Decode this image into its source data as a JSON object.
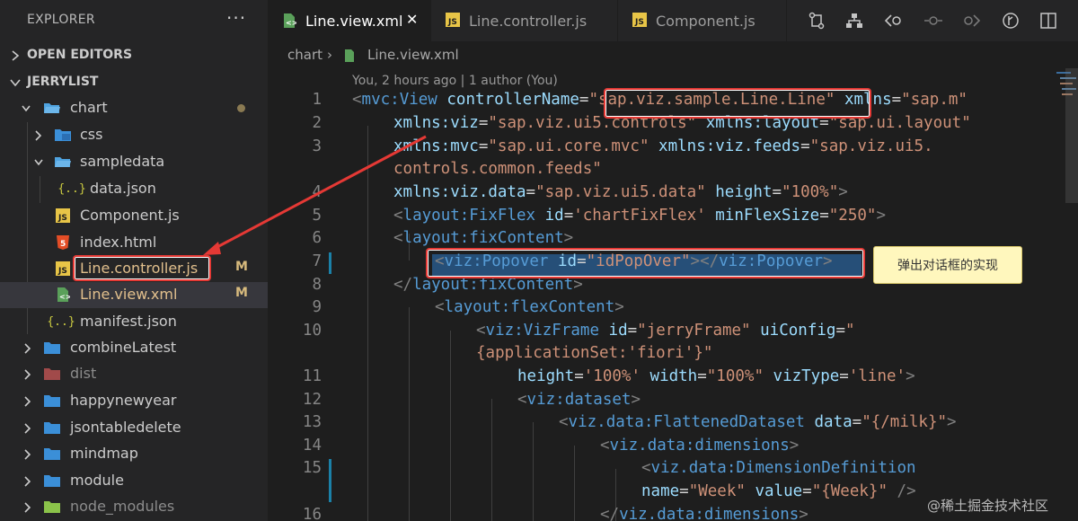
{
  "explorer": {
    "title": "EXPLORER",
    "more": "···",
    "open_editors": "OPEN EDITORS",
    "root": "JERRYLIST",
    "items": [
      {
        "name": "chart",
        "kind": "folder-open"
      },
      {
        "name": "css",
        "kind": "folder"
      },
      {
        "name": "sampledata",
        "kind": "folder-open"
      },
      {
        "name": "data.json",
        "kind": "json"
      },
      {
        "name": "Component.js",
        "kind": "js"
      },
      {
        "name": "index.html",
        "kind": "html"
      },
      {
        "name": "Line.controller.js",
        "kind": "js",
        "badge": "M"
      },
      {
        "name": "Line.view.xml",
        "kind": "xml",
        "badge": "M"
      },
      {
        "name": "manifest.json",
        "kind": "json"
      },
      {
        "name": "combineLatest",
        "kind": "folder"
      },
      {
        "name": "dist",
        "kind": "folder"
      },
      {
        "name": "happynewyear",
        "kind": "folder"
      },
      {
        "name": "jsontabledelete",
        "kind": "folder"
      },
      {
        "name": "mindmap",
        "kind": "folder"
      },
      {
        "name": "module",
        "kind": "folder"
      },
      {
        "name": "node_modules",
        "kind": "folder"
      }
    ]
  },
  "tabs": [
    {
      "label": "Line.view.xml",
      "close": "✕"
    },
    {
      "label": "Line.controller.js"
    },
    {
      "label": "Component.js"
    }
  ],
  "breadcrumb": {
    "folder": "chart",
    "sep": "›",
    "file": "Line.view.xml"
  },
  "codelens": "You, 2 hours ago | 1 author (You)",
  "callout": "弹出对话框的实现",
  "watermark": "@稀土掘金技术社区",
  "colors": {
    "tag": "#569cd6",
    "attr": "#9cdcfe",
    "string": "#ce9178",
    "highlight": "#e53935",
    "selection": "#264f78"
  },
  "code_lines": [
    {
      "n": "1",
      "tokens": [
        [
          "pun",
          "<"
        ],
        [
          "tag",
          "mvc:View"
        ],
        [
          "txt",
          " "
        ],
        [
          "attr",
          "controllerName"
        ],
        [
          "txt",
          "="
        ],
        [
          "str",
          "\"sap.viz.sample.Line.Line\""
        ],
        [
          "txt",
          " "
        ],
        [
          "attr",
          "xmlns"
        ],
        [
          "txt",
          "="
        ],
        [
          "str",
          "\"sap.m\""
        ]
      ]
    },
    {
      "n": "2",
      "tokens": [
        [
          "attr",
          "xmlns:viz"
        ],
        [
          "txt",
          "="
        ],
        [
          "str",
          "\"sap.viz.ui5.controls\""
        ],
        [
          "txt",
          " "
        ],
        [
          "attr",
          "xmlns:layout"
        ],
        [
          "txt",
          "="
        ],
        [
          "str",
          "\"sap.ui.layout\""
        ]
      ]
    },
    {
      "n": "3",
      "tokens": [
        [
          "attr",
          "xmlns:mvc"
        ],
        [
          "txt",
          "="
        ],
        [
          "str",
          "\"sap.ui.core.mvc\""
        ],
        [
          "txt",
          " "
        ],
        [
          "attr",
          "xmlns:viz.feeds"
        ],
        [
          "txt",
          "="
        ],
        [
          "str",
          "\"sap.viz.ui5."
        ]
      ]
    },
    {
      "n": "",
      "tokens": [
        [
          "str",
          "controls.common.feeds\""
        ]
      ]
    },
    {
      "n": "4",
      "tokens": [
        [
          "attr",
          "xmlns:viz.data"
        ],
        [
          "txt",
          "="
        ],
        [
          "str",
          "\"sap.viz.ui5.data\""
        ],
        [
          "txt",
          " "
        ],
        [
          "attr",
          "height"
        ],
        [
          "txt",
          "="
        ],
        [
          "str",
          "\"100%\""
        ],
        [
          "pun",
          ">"
        ]
      ]
    },
    {
      "n": "5",
      "tokens": [
        [
          "pun",
          "<"
        ],
        [
          "tag",
          "layout:FixFlex"
        ],
        [
          "txt",
          " "
        ],
        [
          "attr",
          "id"
        ],
        [
          "txt",
          "="
        ],
        [
          "str",
          "'chartFixFlex'"
        ],
        [
          "txt",
          " "
        ],
        [
          "attr",
          "minFlexSize"
        ],
        [
          "txt",
          "="
        ],
        [
          "str",
          "\"250\""
        ],
        [
          "pun",
          ">"
        ]
      ]
    },
    {
      "n": "6",
      "tokens": [
        [
          "pun",
          "<"
        ],
        [
          "tag",
          "layout:fixContent"
        ],
        [
          "pun",
          ">"
        ]
      ]
    },
    {
      "n": "7",
      "tokens": [
        [
          "pun",
          "<"
        ],
        [
          "tag",
          "viz:Popover"
        ],
        [
          "txt",
          " "
        ],
        [
          "attr",
          "id"
        ],
        [
          "txt",
          "="
        ],
        [
          "str",
          "\"idPopOver\""
        ],
        [
          "pun",
          "></"
        ],
        [
          "tag",
          "viz:Popover"
        ],
        [
          "pun",
          ">"
        ]
      ]
    },
    {
      "n": "8",
      "tokens": [
        [
          "pun",
          "</"
        ],
        [
          "tag",
          "layout:fixContent"
        ],
        [
          "pun",
          ">"
        ]
      ]
    },
    {
      "n": "9",
      "tokens": [
        [
          "pun",
          "<"
        ],
        [
          "tag",
          "layout:flexContent"
        ],
        [
          "pun",
          ">"
        ]
      ]
    },
    {
      "n": "10",
      "tokens": [
        [
          "pun",
          "<"
        ],
        [
          "tag",
          "viz:VizFrame"
        ],
        [
          "txt",
          " "
        ],
        [
          "attr",
          "id"
        ],
        [
          "txt",
          "="
        ],
        [
          "str",
          "\"jerryFrame\""
        ],
        [
          "txt",
          " "
        ],
        [
          "attr",
          "uiConfig"
        ],
        [
          "txt",
          "="
        ],
        [
          "str",
          "\""
        ]
      ]
    },
    {
      "n": "",
      "tokens": [
        [
          "str",
          "{applicationSet:'fiori'}\""
        ]
      ]
    },
    {
      "n": "11",
      "tokens": [
        [
          "attr",
          "height"
        ],
        [
          "txt",
          "="
        ],
        [
          "str",
          "'100%'"
        ],
        [
          "txt",
          " "
        ],
        [
          "attr",
          "width"
        ],
        [
          "txt",
          "="
        ],
        [
          "str",
          "\"100%\""
        ],
        [
          "txt",
          " "
        ],
        [
          "attr",
          "vizType"
        ],
        [
          "txt",
          "="
        ],
        [
          "str",
          "'line'"
        ],
        [
          "pun",
          ">"
        ]
      ]
    },
    {
      "n": "12",
      "tokens": [
        [
          "pun",
          "<"
        ],
        [
          "tag",
          "viz:dataset"
        ],
        [
          "pun",
          ">"
        ]
      ]
    },
    {
      "n": "13",
      "tokens": [
        [
          "pun",
          "<"
        ],
        [
          "tag",
          "viz.data:FlattenedDataset"
        ],
        [
          "txt",
          " "
        ],
        [
          "attr",
          "data"
        ],
        [
          "txt",
          "="
        ],
        [
          "str",
          "\"{/milk}\""
        ],
        [
          "pun",
          ">"
        ]
      ]
    },
    {
      "n": "14",
      "tokens": [
        [
          "pun",
          "<"
        ],
        [
          "tag",
          "viz.data:dimensions"
        ],
        [
          "pun",
          ">"
        ]
      ]
    },
    {
      "n": "15",
      "tokens": [
        [
          "pun",
          "<"
        ],
        [
          "tag",
          "viz.data:DimensionDefinition"
        ]
      ]
    },
    {
      "n": "",
      "tokens": [
        [
          "attr",
          "name"
        ],
        [
          "txt",
          "="
        ],
        [
          "str",
          "\"Week\""
        ],
        [
          "txt",
          " "
        ],
        [
          "attr",
          "value"
        ],
        [
          "txt",
          "="
        ],
        [
          "str",
          "\"{Week}\""
        ],
        [
          "txt",
          " "
        ],
        [
          "pun",
          "/>"
        ]
      ]
    },
    {
      "n": "16",
      "tokens": [
        [
          "pun",
          "</"
        ],
        [
          "tag",
          "viz.data:dimensions"
        ],
        [
          "pun",
          ">"
        ]
      ]
    }
  ]
}
